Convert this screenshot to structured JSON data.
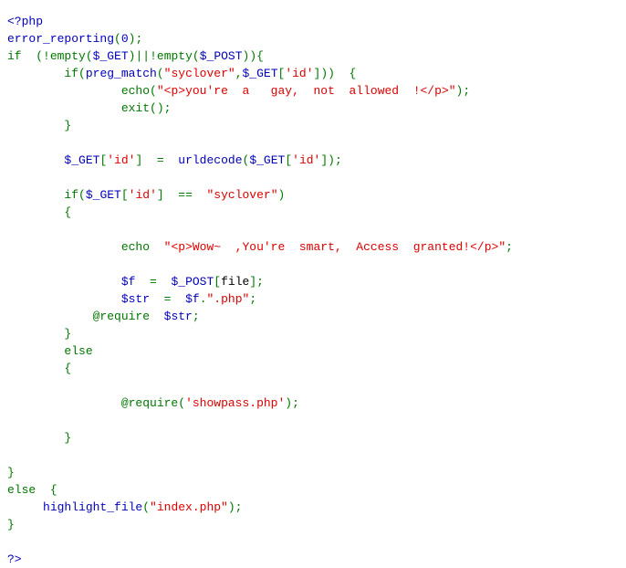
{
  "document": {
    "kind": "php-source-listing",
    "title": "PHP source code listing (highlight_file output)",
    "background_color": "#FFFFFF",
    "colors": {
      "keyword_green": "#007700",
      "string_red": "#DD0000",
      "variable_blue": "#0000BB",
      "function_blue": "#0000BB",
      "default_black": "#000000"
    }
  },
  "code": {
    "language": "php",
    "lines": [
      {
        "n": 1,
        "text": "<?php"
      },
      {
        "n": 2,
        "text": "error_reporting(0);"
      },
      {
        "n": 3,
        "text": "if  (!empty($_GET)||!empty($_POST)){"
      },
      {
        "n": 4,
        "text": "        if(preg_match(\"syclover\",$_GET['id']))  {"
      },
      {
        "n": 5,
        "text": "                echo(\"<p>you're  a   gay,  not  allowed  !</p>\");"
      },
      {
        "n": 6,
        "text": "                exit();"
      },
      {
        "n": 7,
        "text": "        }"
      },
      {
        "n": 8,
        "text": ""
      },
      {
        "n": 9,
        "text": "        $_GET['id']  =  urldecode($_GET['id']);"
      },
      {
        "n": 10,
        "text": ""
      },
      {
        "n": 11,
        "text": "        if($_GET['id']  ==  \"syclover\")"
      },
      {
        "n": 12,
        "text": "        {"
      },
      {
        "n": 13,
        "text": ""
      },
      {
        "n": 14,
        "text": "                echo  \"<p>Wow~  ,You're  smart,  Access  granted!</p>\";"
      },
      {
        "n": 15,
        "text": ""
      },
      {
        "n": 16,
        "text": "                $f  =  $_POST[file];"
      },
      {
        "n": 17,
        "text": "                $str  =  $f.\".php\";"
      },
      {
        "n": 18,
        "text": "            @require  $str;"
      },
      {
        "n": 19,
        "text": "        }"
      },
      {
        "n": 20,
        "text": "        else"
      },
      {
        "n": 21,
        "text": "        {"
      },
      {
        "n": 22,
        "text": ""
      },
      {
        "n": 23,
        "text": "                @require('showpass.php');"
      },
      {
        "n": 24,
        "text": ""
      },
      {
        "n": 25,
        "text": "        }"
      },
      {
        "n": 26,
        "text": ""
      },
      {
        "n": 27,
        "text": "}"
      },
      {
        "n": 28,
        "text": "else  {"
      },
      {
        "n": 29,
        "text": "     highlight_file(\"index.php\");"
      },
      {
        "n": 30,
        "text": "}"
      },
      {
        "n": 31,
        "text": ""
      },
      {
        "n": 32,
        "text": "?>"
      }
    ],
    "tokens": {
      "php_open": "<?php",
      "php_close": "?>",
      "fn_error_reporting": "error_reporting",
      "kw_if": "if",
      "kw_else": "else",
      "kw_echo": "echo",
      "kw_exit": "exit",
      "kw_require": "@require",
      "fn_empty": "empty",
      "fn_preg_match": "preg_match",
      "fn_urldecode": "urldecode",
      "fn_highlight_file": "highlight_file",
      "var_get": "$_GET",
      "var_post": "$_POST",
      "var_f": "$f",
      "var_str": "$str",
      "key_id": "'id'",
      "key_file": "file",
      "str_syclover": "\"syclover\"",
      "str_deny": "\"<p>you're  a   gay,  not  allowed  !</p>\"",
      "str_grant": "\"<p>Wow~  ,You're  smart,  Access  granted!</p>\"",
      "str_php_ext": "\".php\"",
      "str_showpass": "'showpass.php'",
      "str_index": "\"index.php\"",
      "num_zero": "0"
    }
  }
}
